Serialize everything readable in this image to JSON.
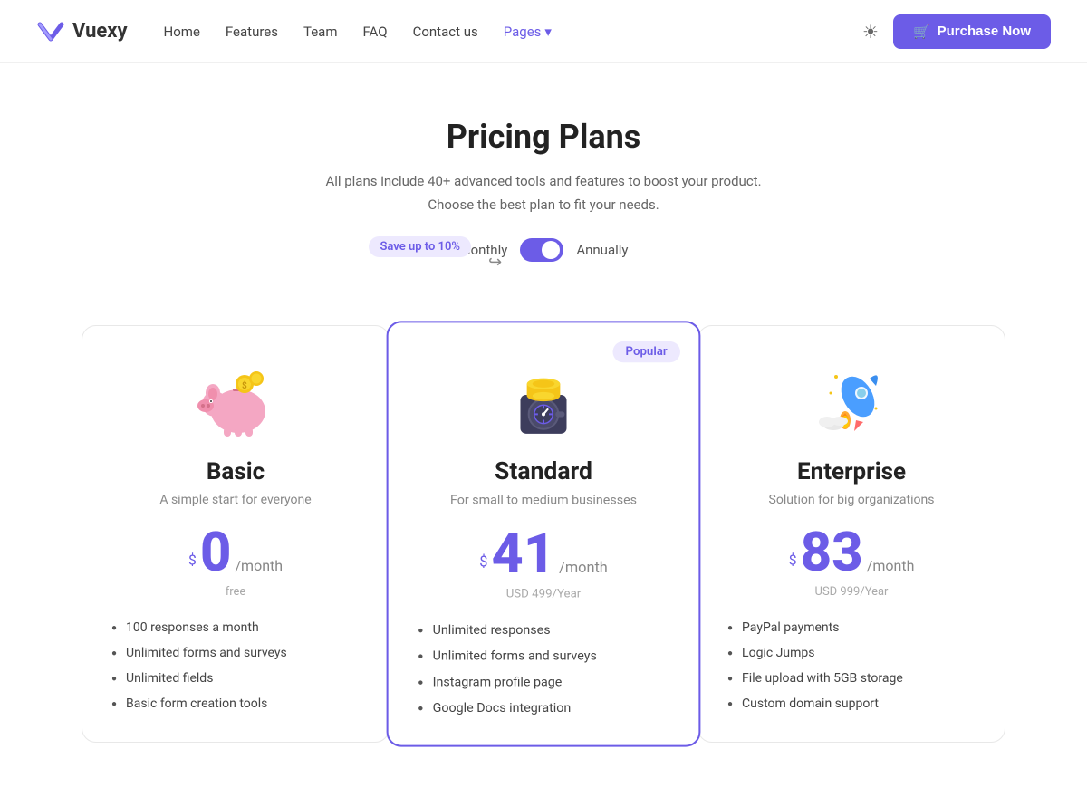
{
  "navbar": {
    "logo_text": "Vuexy",
    "links": [
      {
        "label": "Home",
        "active": false
      },
      {
        "label": "Features",
        "active": false
      },
      {
        "label": "Team",
        "active": false
      },
      {
        "label": "FAQ",
        "active": false
      },
      {
        "label": "Contact us",
        "active": false
      },
      {
        "label": "Pages",
        "active": true,
        "has_dropdown": true
      }
    ],
    "purchase_label": "Purchase Now"
  },
  "hero": {
    "title": "Pricing Plans",
    "description_line1": "All plans include 40+ advanced tools and features to boost your product.",
    "description_line2": "Choose the best plan to fit your needs.",
    "save_badge": "Save up to 10%",
    "billing_monthly": "Monthly",
    "billing_annually": "Annually"
  },
  "plans": [
    {
      "id": "basic",
      "name": "Basic",
      "subtitle": "A simple start for everyone",
      "price": "0",
      "period": "/month",
      "sub_label": "free",
      "popular": false,
      "features": [
        "100 responses a month",
        "Unlimited forms and surveys",
        "Unlimited fields",
        "Basic form creation tools"
      ]
    },
    {
      "id": "standard",
      "name": "Standard",
      "subtitle": "For small to medium businesses",
      "price": "41",
      "period": "/month",
      "sub_label": "USD 499/Year",
      "popular": true,
      "popular_label": "Popular",
      "features": [
        "Unlimited responses",
        "Unlimited forms and surveys",
        "Instagram profile page",
        "Google Docs integration"
      ]
    },
    {
      "id": "enterprise",
      "name": "Enterprise",
      "subtitle": "Solution for big organizations",
      "price": "83",
      "period": "/month",
      "sub_label": "USD 999/Year",
      "popular": false,
      "features": [
        "PayPal payments",
        "Logic Jumps",
        "File upload with 5GB storage",
        "Custom domain support"
      ]
    }
  ]
}
